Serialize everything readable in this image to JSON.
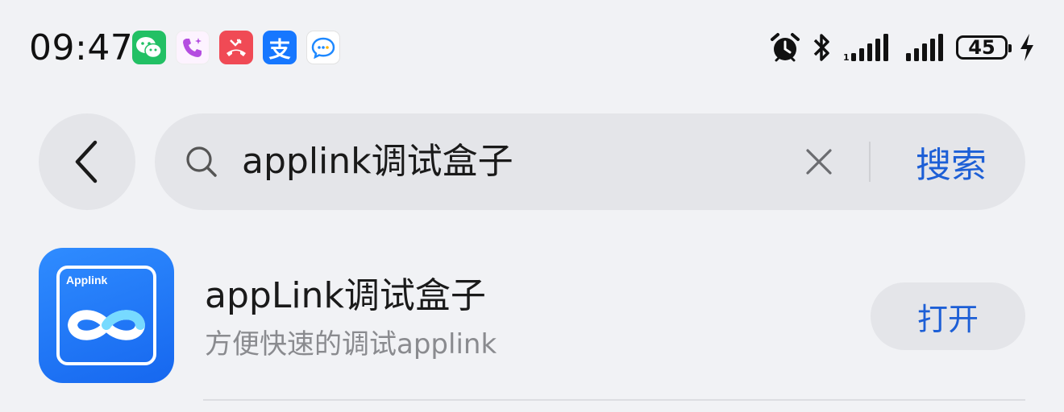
{
  "status_bar": {
    "time": "09:47",
    "battery_level": "45",
    "notification_icons": [
      "wechat-icon",
      "phone-call-icon",
      "missed-call-icon",
      "alipay-icon",
      "message-icon"
    ],
    "alipay_glyph": "支",
    "system_icons": [
      "alarm-icon",
      "bluetooth-icon",
      "signal-1-icon",
      "signal-2-icon",
      "battery-icon",
      "charging-icon"
    ]
  },
  "search": {
    "query": "applink调试盒子",
    "button_label": "搜索"
  },
  "results": [
    {
      "name": "appLink调试盒子",
      "description": "方便快速的调试applink",
      "icon_label": "Applink",
      "action_label": "打开"
    }
  ],
  "colors": {
    "background": "#f1f2f5",
    "pill": "#e4e5e9",
    "accent": "#1d5fd6",
    "app_icon": "#1f74f6"
  }
}
